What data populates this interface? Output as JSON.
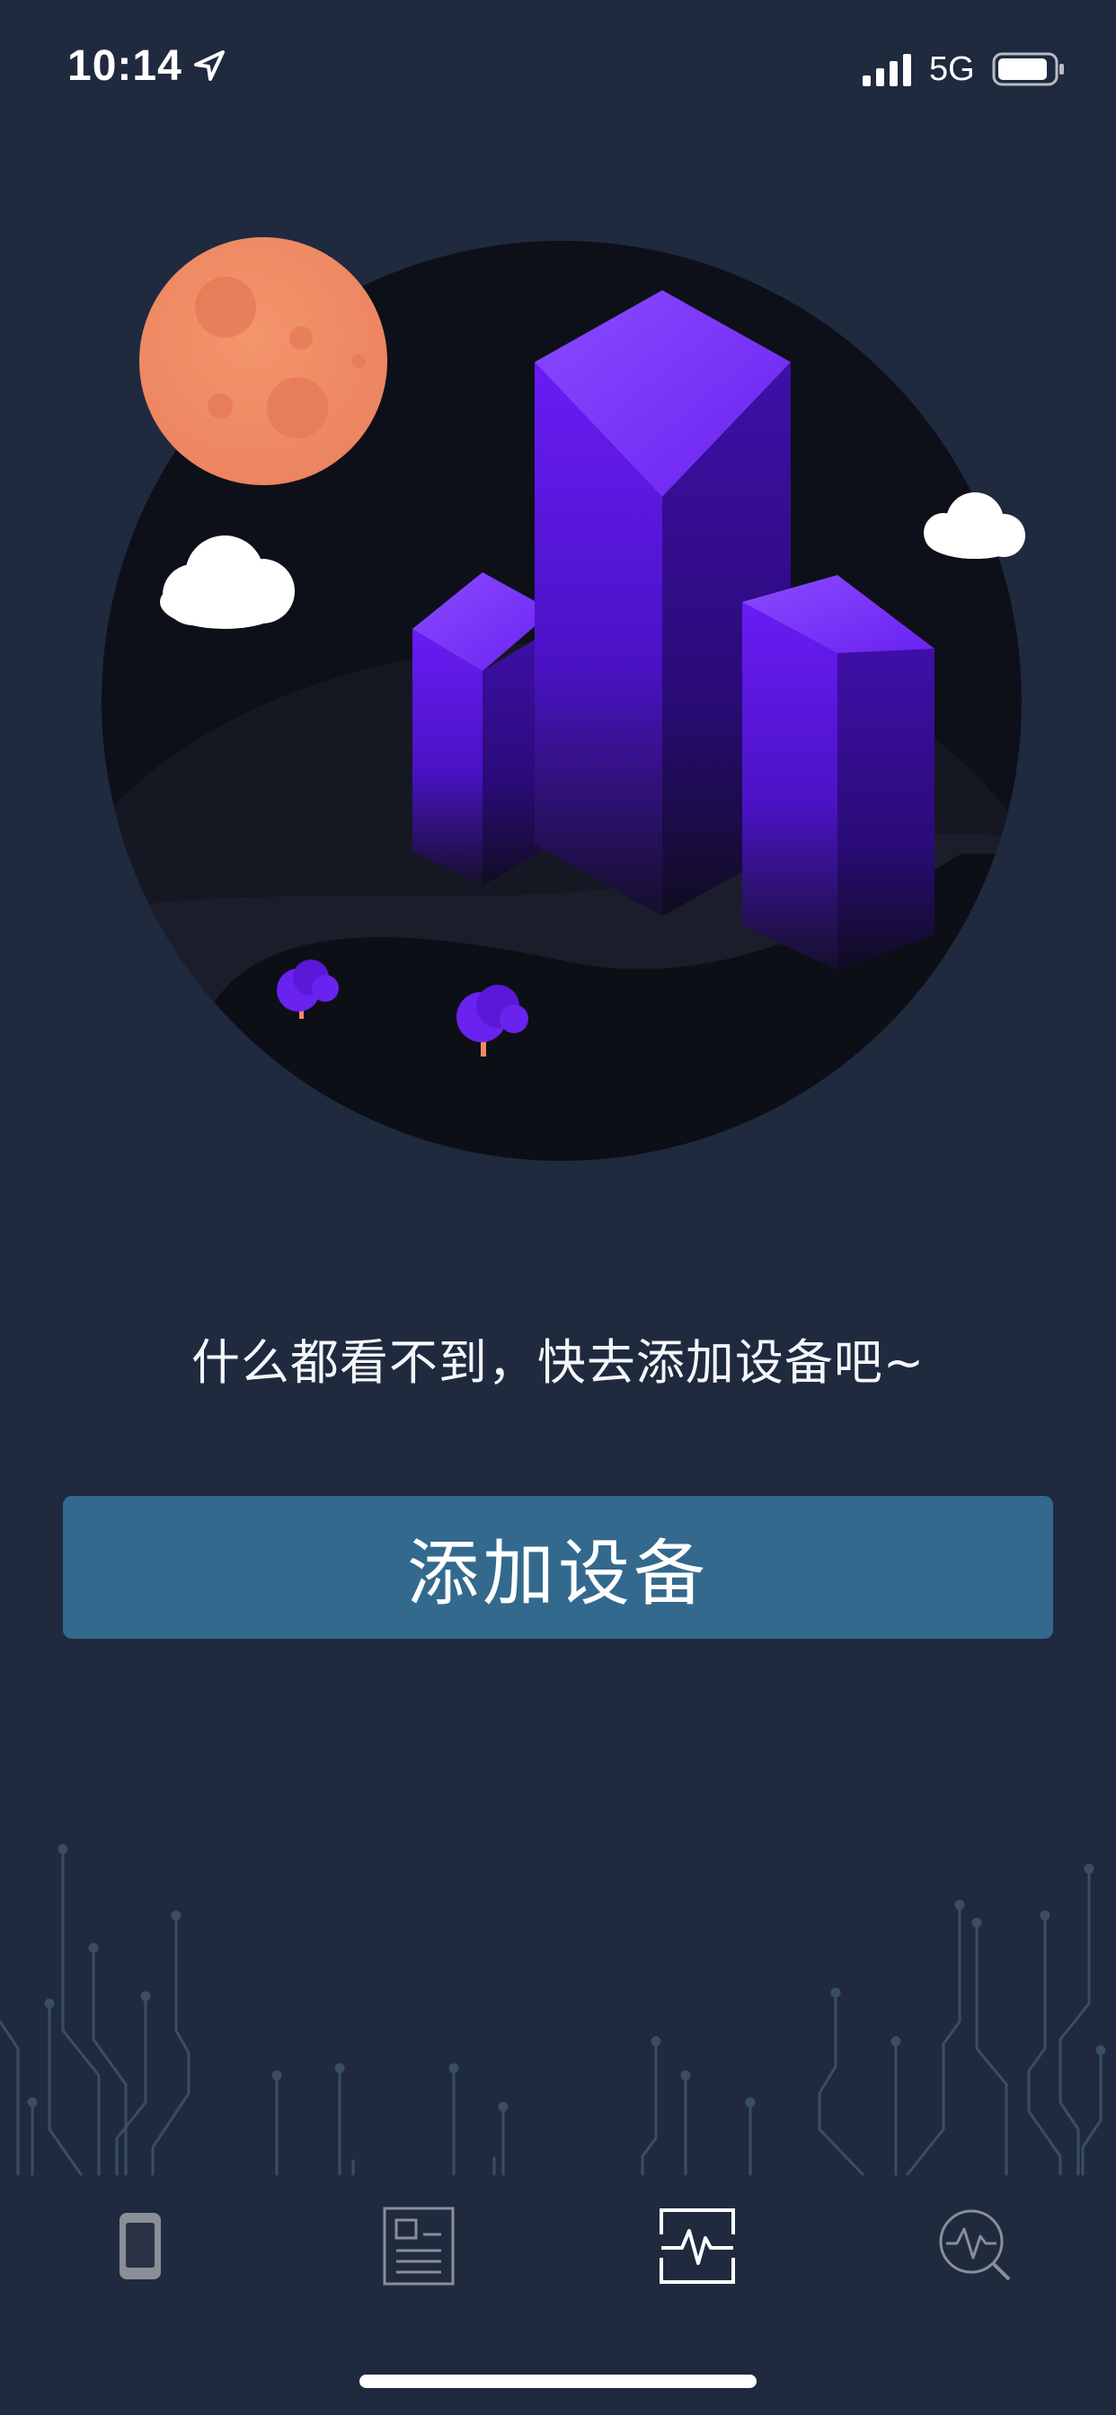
{
  "status_bar": {
    "time": "10:14",
    "network": "5G"
  },
  "main": {
    "empty_message": "什么都看不到，快去添加设备吧~",
    "add_button_label": "添加设备"
  },
  "tabs": [
    {
      "id": "devices",
      "icon": "phone-icon",
      "active": false
    },
    {
      "id": "reports",
      "icon": "document-icon",
      "active": false
    },
    {
      "id": "monitor",
      "icon": "heart-rate-icon",
      "active": true
    },
    {
      "id": "analysis",
      "icon": "search-pulse-icon",
      "active": false
    }
  ],
  "colors": {
    "background": "#1f2a3f",
    "button": "#33698d",
    "building": "#5b16e8",
    "moon": "#ef8a63",
    "inactive_icon": "#8a8e97",
    "active_icon": "#ffffff"
  }
}
